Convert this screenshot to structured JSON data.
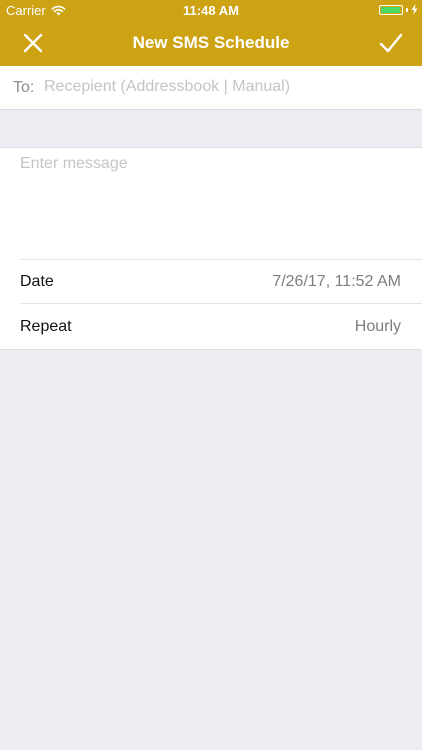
{
  "status_bar": {
    "carrier": "Carrier",
    "time": "11:48 AM",
    "battery_level": 0.95,
    "battery_color": "#4cd964"
  },
  "nav": {
    "title": "New SMS Schedule",
    "close_icon": "close-icon",
    "confirm_icon": "checkmark-icon",
    "background": "#cda313"
  },
  "recipient": {
    "label": "To:",
    "placeholder": "Recepient (Addressbook | Manual)",
    "value": ""
  },
  "message": {
    "placeholder": "Enter message",
    "value": ""
  },
  "schedule": {
    "date_label": "Date",
    "date_value": "7/26/17, 11:52 AM",
    "repeat_label": "Repeat",
    "repeat_value": "Hourly"
  }
}
